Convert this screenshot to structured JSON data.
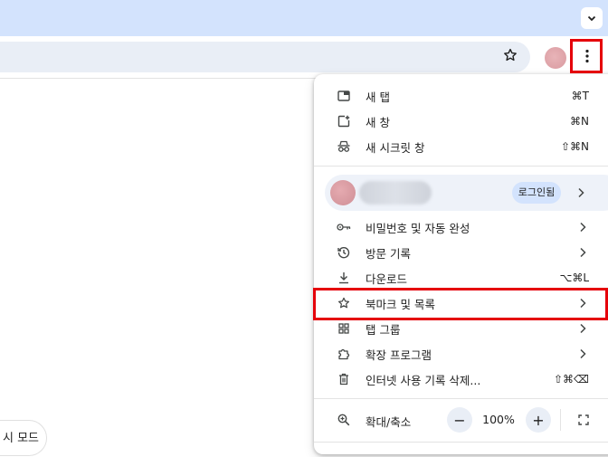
{
  "colors": {
    "tabstrip": "#d3e3fd",
    "omnibox": "#e9eef6",
    "highlight": "#e5000a",
    "chip": "#d3e3fd"
  },
  "bottom_chip": {
    "label": "시 모드"
  },
  "menu": {
    "group1": [
      {
        "icon": "new-tab-icon",
        "label": "새 탭",
        "shortcut": "⌘T"
      },
      {
        "icon": "new-window-icon",
        "label": "새 창",
        "shortcut": "⌘N"
      },
      {
        "icon": "incognito-icon",
        "label": "새 시크릿 창",
        "shortcut": "⇧⌘N"
      }
    ],
    "profile": {
      "signed_in_label": "로그인됨"
    },
    "group2": [
      {
        "icon": "key-icon",
        "label": "비밀번호 및 자동 완성",
        "shortcut": ""
      },
      {
        "icon": "history-icon",
        "label": "방문 기록",
        "shortcut": ""
      },
      {
        "icon": "download-icon",
        "label": "다운로드",
        "shortcut": "⌥⌘L"
      },
      {
        "icon": "star-icon",
        "label": "북마크 및 목록",
        "shortcut": ""
      },
      {
        "icon": "tab-groups-icon",
        "label": "탭 그룹",
        "shortcut": ""
      },
      {
        "icon": "extensions-icon",
        "label": "확장 프로그램",
        "shortcut": ""
      },
      {
        "icon": "trash-icon",
        "label": "인터넷 사용 기록 삭제...",
        "shortcut": "⇧⌘⌫"
      }
    ],
    "zoom": {
      "label": "확대/축소",
      "minus": "−",
      "value": "100%",
      "plus": "+"
    }
  }
}
